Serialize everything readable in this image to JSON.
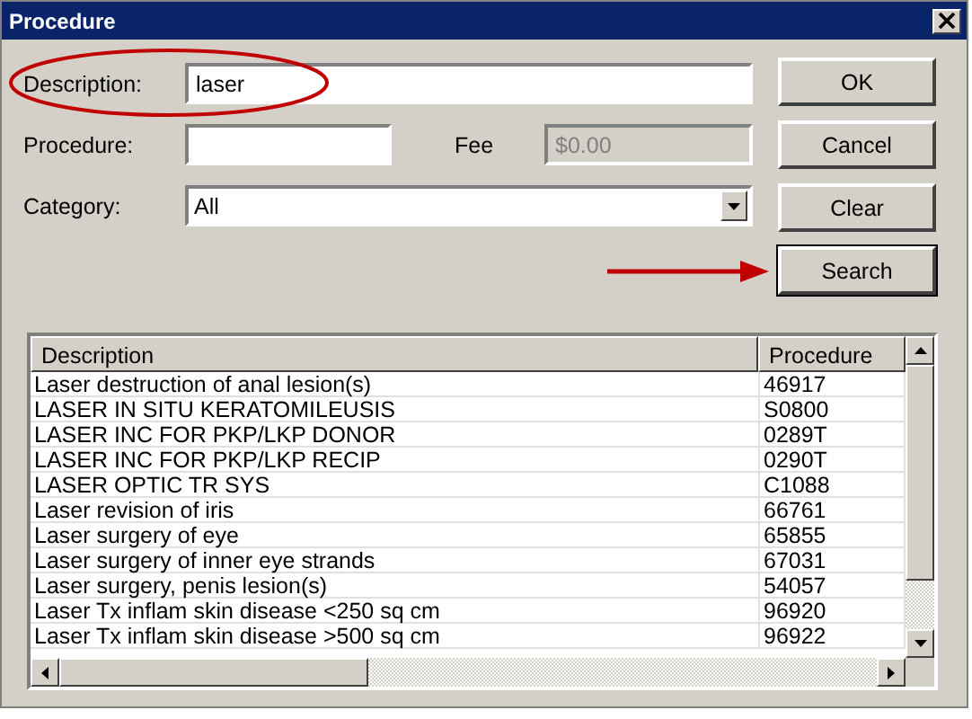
{
  "window": {
    "title": "Procedure"
  },
  "description": {
    "label": "Description:",
    "value": "laser"
  },
  "procedure": {
    "label": "Procedure:"
  },
  "fee": {
    "label": "Fee",
    "value": "$0.00",
    "disabled": true
  },
  "category": {
    "label": "Category:",
    "value": "All"
  },
  "buttons": [
    {
      "label": "OK",
      "default": false
    },
    {
      "label": "Cancel",
      "default": false
    },
    {
      "label": "Clear",
      "default": false
    },
    {
      "label": "Search",
      "default": true
    }
  ],
  "table": {
    "columns": [
      "Description",
      "Procedure"
    ],
    "rows": [
      [
        "Laser destruction of anal lesion(s)",
        "46917"
      ],
      [
        "LASER IN SITU KERATOMILEUSIS",
        "S0800"
      ],
      [
        "LASER INC FOR PKP/LKP DONOR",
        "0289T"
      ],
      [
        "LASER INC FOR PKP/LKP RECIP",
        "0290T"
      ],
      [
        "LASER OPTIC TR SYS",
        "C1088"
      ],
      [
        "Laser revision of iris",
        "66761"
      ],
      [
        "Laser surgery of eye",
        "65855"
      ],
      [
        "Laser surgery of inner eye strands",
        "67031"
      ],
      [
        "Laser surgery, penis lesion(s)",
        "54057"
      ],
      [
        "Laser Tx inflam skin disease <250 sq cm",
        "96920"
      ],
      [
        "Laser Tx inflam skin disease >500 sq cm",
        "96922"
      ]
    ]
  },
  "annotations": [
    {
      "kind": "ellipse"
    },
    {
      "kind": "arrow"
    }
  ]
}
